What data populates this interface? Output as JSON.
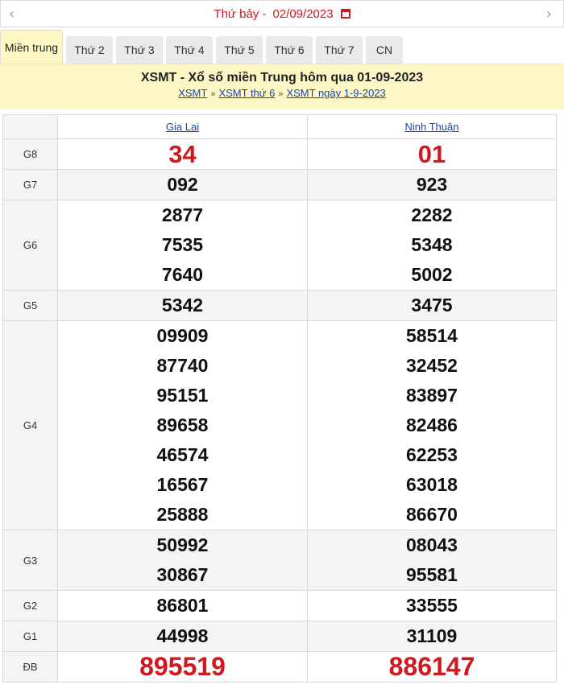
{
  "date_bar": {
    "prev_icon": "chevron-left-icon",
    "next_icon": "chevron-right-icon",
    "day_label": "Thứ bảy -",
    "date_value": "02/09/2023",
    "calendar_icon": "calendar-icon",
    "accent_color": "#d0181f"
  },
  "tabs": [
    {
      "label": "Miền trung",
      "active": true
    },
    {
      "label": "Thứ 2"
    },
    {
      "label": "Thứ 3"
    },
    {
      "label": "Thứ 4"
    },
    {
      "label": "Thứ 5"
    },
    {
      "label": "Thứ 6"
    },
    {
      "label": "Thứ 7"
    },
    {
      "label": "CN"
    }
  ],
  "header": {
    "title": "XSMT - Xổ số miền Trung hôm qua 01-09-2023",
    "breadcrumbs": [
      "XSMT",
      "XSMT thứ 6",
      "XSMT ngày 1-9-2023"
    ],
    "separator": "»",
    "background": "#fdf7c6"
  },
  "provinces": [
    "Gia Lai",
    "Ninh Thuận"
  ],
  "prizes": [
    {
      "label": "G8",
      "style": "red",
      "values": [
        [
          "34"
        ],
        [
          "01"
        ]
      ]
    },
    {
      "label": "G7",
      "values": [
        [
          "092"
        ],
        [
          "923"
        ]
      ]
    },
    {
      "label": "G6",
      "values": [
        [
          "2877",
          "7535",
          "7640"
        ],
        [
          "2282",
          "5348",
          "5002"
        ]
      ]
    },
    {
      "label": "G5",
      "values": [
        [
          "5342"
        ],
        [
          "3475"
        ]
      ]
    },
    {
      "label": "G4",
      "values": [
        [
          "09909",
          "87740",
          "95151",
          "89658",
          "46574",
          "16567",
          "25888"
        ],
        [
          "58514",
          "32452",
          "83897",
          "82486",
          "62253",
          "63018",
          "86670"
        ]
      ]
    },
    {
      "label": "G3",
      "values": [
        [
          "50992",
          "30867"
        ],
        [
          "08043",
          "95581"
        ]
      ]
    },
    {
      "label": "G2",
      "values": [
        [
          "86801"
        ],
        [
          "33555"
        ]
      ]
    },
    {
      "label": "G1",
      "values": [
        [
          "44998"
        ],
        [
          "31109"
        ]
      ]
    },
    {
      "label": "ĐB",
      "style": "big",
      "values": [
        [
          "895519"
        ],
        [
          "886147"
        ]
      ]
    }
  ]
}
